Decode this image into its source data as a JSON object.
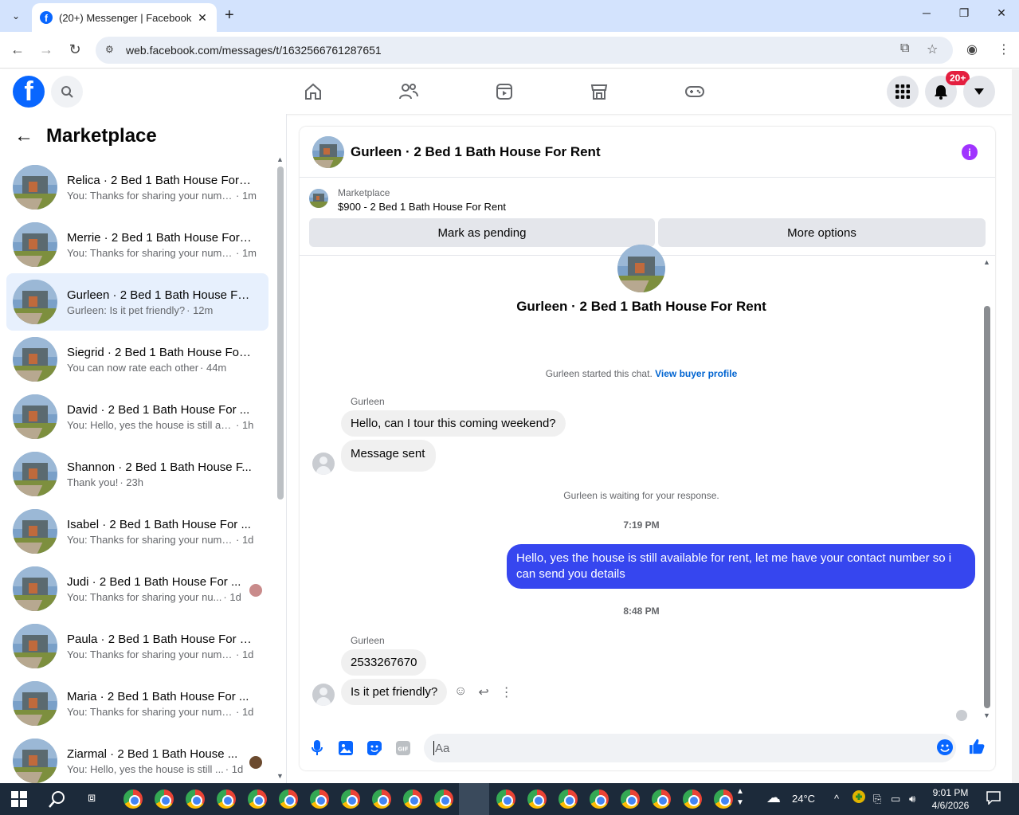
{
  "browser": {
    "tab_title": "(20+) Messenger | Facebook",
    "url": "web.facebook.com/messages/t/1632566761287651"
  },
  "topbar": {
    "notification_count": "20+"
  },
  "sidebar": {
    "title": "Marketplace",
    "conversations": [
      {
        "name": "Relica · 2 Bed 1 Bath House For ...",
        "preview": "You: Thanks for sharing your numb...",
        "time": "· 1m"
      },
      {
        "name": "Merrie · 2 Bed 1 Bath House For ...",
        "preview": "You: Thanks for sharing your numb...",
        "time": "· 1m"
      },
      {
        "name": "Gurleen · 2 Bed 1 Bath House Fo...",
        "preview": "Gurleen: Is it pet friendly?",
        "time": "· 12m"
      },
      {
        "name": "Siegrid · 2 Bed 1 Bath House For...",
        "preview": "You can now rate each other",
        "time": "· 44m"
      },
      {
        "name": "David · 2 Bed 1 Bath House For ...",
        "preview": "You: Hello, yes the house is still avai...",
        "time": "· 1h"
      },
      {
        "name": "Shannon · 2 Bed 1 Bath House F...",
        "preview": "Thank you!",
        "time": "· 23h"
      },
      {
        "name": "Isabel · 2 Bed 1 Bath House For ...",
        "preview": "You: Thanks for sharing your numb...",
        "time": "· 1d"
      },
      {
        "name": "Judi · 2 Bed 1 Bath House For ...",
        "preview": "You: Thanks for sharing your nu...",
        "time": "· 1d"
      },
      {
        "name": "Paula · 2 Bed 1 Bath House For R...",
        "preview": "You: Thanks for sharing your numb...",
        "time": "· 1d"
      },
      {
        "name": "Maria · 2 Bed 1 Bath House For ...",
        "preview": "You: Thanks for sharing your numb...",
        "time": "· 1d"
      },
      {
        "name": "Ziarmal · 2 Bed 1 Bath House ...",
        "preview": "You: Hello, yes the house is still ...",
        "time": "· 1d"
      }
    ]
  },
  "chat": {
    "title": "Gurleen · 2 Bed 1 Bath House For Rent",
    "listing_label": "Marketplace",
    "listing_price": "$900 - 2 Bed 1 Bath House For Rent",
    "mark_pending": "Mark as pending",
    "more_options": "More options",
    "center_title": "Gurleen · 2 Bed 1 Bath House For Rent",
    "started_text": "Gurleen started this chat.",
    "view_profile": "View buyer profile",
    "sender1": "Gurleen",
    "msg1": "Hello, can I tour this coming weekend?",
    "msg2": "Message sent",
    "waiting": "Gurleen is waiting for your response.",
    "time1": "7:19 PM",
    "msg3": "Hello, yes the house is still available for rent, let me have your contact number so i can send you  details",
    "time2": "8:48 PM",
    "sender2": "Gurleen",
    "msg4": "2533267670",
    "msg5": "Is it pet friendly?",
    "input_placeholder": "Aa"
  },
  "taskbar": {
    "temperature": "24°C",
    "time": "9:01 PM",
    "date": "4/6/2026"
  },
  "colors": {
    "fb_blue": "#0866ff",
    "outgoing_bubble": "#3646ef",
    "active_conv": "#e7f0fd",
    "badge_red": "#e41e3f"
  }
}
